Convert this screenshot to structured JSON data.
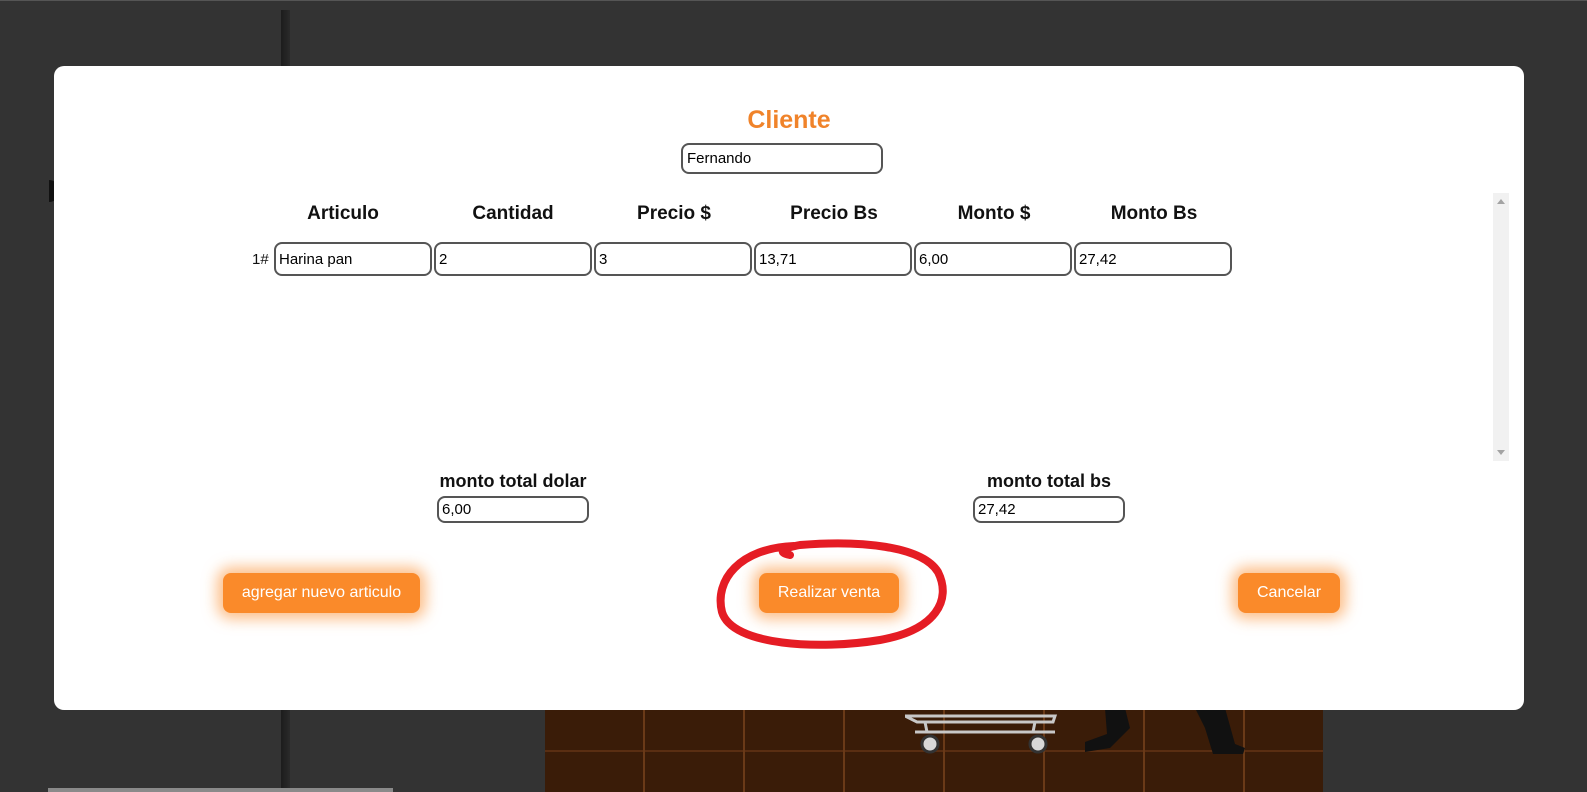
{
  "modal": {
    "cliente_title": "Cliente",
    "cliente_value": "Fernando",
    "columns": [
      "Articulo",
      "Cantidad",
      "Precio $",
      "Precio Bs",
      "Monto $",
      "Monto Bs"
    ],
    "rows": [
      {
        "number": "1#",
        "articulo": "Harina pan",
        "cantidad": "2",
        "precio_usd": "3",
        "precio_bs": "13,71",
        "monto_usd": "6,00",
        "monto_bs": "27,42"
      }
    ],
    "totals": {
      "dolar_label": "monto total dolar",
      "dolar_value": "6,00",
      "bs_label": "monto total bs",
      "bs_value": "27,42"
    },
    "buttons": {
      "add_label": "agregar nuevo articulo",
      "sale_label": "Realizar venta",
      "cancel_label": "Cancelar"
    }
  },
  "colors": {
    "accent": "#f0832a",
    "button": "#fa8a2a",
    "annotation": "#e51c24",
    "backdrop": "#333333"
  }
}
